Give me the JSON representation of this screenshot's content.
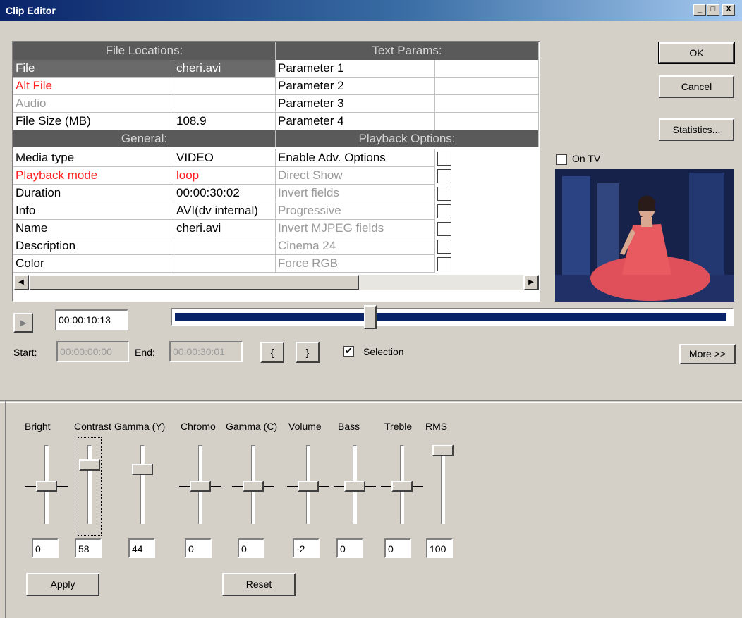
{
  "window": {
    "title": "Clip Editor",
    "min_label": "_",
    "max_label": "□",
    "close_label": "X"
  },
  "buttons": {
    "ok": "OK",
    "cancel": "Cancel",
    "statistics": "Statistics...",
    "more": "More >>",
    "apply": "Apply",
    "reset": "Reset",
    "mark_in": "{",
    "mark_out": "}"
  },
  "grid": {
    "file_locations_header": "File Locations:",
    "text_params_header": "Text Params:",
    "general_header": "General:",
    "playback_header": "Playback Options:",
    "file_rows": [
      {
        "label": "File",
        "value": "cheri.avi"
      },
      {
        "label": "Alt File",
        "value": ""
      },
      {
        "label": "Audio",
        "value": ""
      },
      {
        "label": "File Size (MB)",
        "value": "108.9"
      }
    ],
    "text_params": [
      "Parameter 1",
      "Parameter 2",
      "Parameter 3",
      "Parameter 4"
    ],
    "general_rows": [
      {
        "label": "Media type",
        "value": "VIDEO"
      },
      {
        "label": "Playback mode",
        "value": "loop"
      },
      {
        "label": "Duration",
        "value": "00:00:30:02"
      },
      {
        "label": "Info",
        "value": "AVI(dv internal)"
      },
      {
        "label": "Name",
        "value": "cheri.avi"
      },
      {
        "label": "Description",
        "value": ""
      },
      {
        "label": "Color",
        "value": ""
      }
    ],
    "playback_options": [
      "Enable Adv. Options",
      "Direct Show",
      "Invert fields",
      "Progressive",
      "Invert MJPEG fields",
      "Cinema 24",
      "Force RGB"
    ]
  },
  "preview": {
    "on_tv_label": "On TV"
  },
  "transport": {
    "timecode": "00:00:10:13",
    "start_label": "Start:",
    "start_value": "00:00:00:00",
    "end_label": "End:",
    "end_value": "00:00:30:01",
    "selection_label": "Selection",
    "position_fraction": 0.35
  },
  "sliders": [
    {
      "label": "Bright",
      "value": "0"
    },
    {
      "label": "Contrast",
      "value": "58"
    },
    {
      "label": "Gamma (Y)",
      "value": "44"
    },
    {
      "label": "Chromo",
      "value": "0"
    },
    {
      "label": "Gamma (C)",
      "value": "0"
    },
    {
      "label": "Volume",
      "value": "-2"
    },
    {
      "label": "Bass",
      "value": "0"
    },
    {
      "label": "Treble",
      "value": "0"
    },
    {
      "label": "RMS",
      "value": "100"
    }
  ]
}
